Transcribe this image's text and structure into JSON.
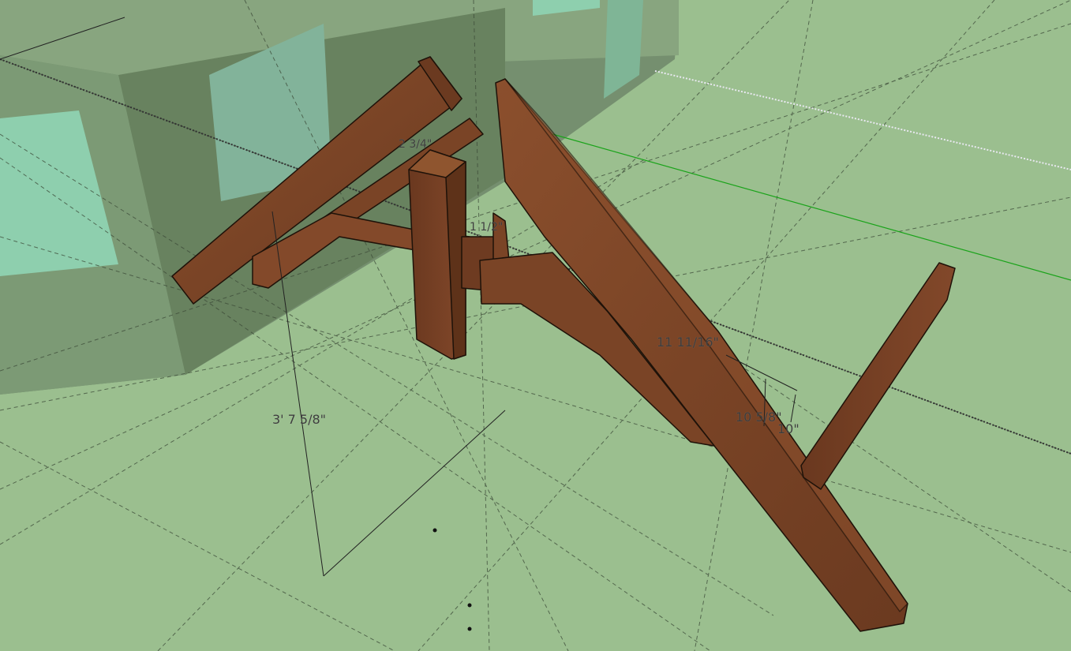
{
  "viewport": {
    "background_color": "#9bbf8f",
    "wood_color": "#7a4426",
    "wood_dark_color": "#4f2a16",
    "wood_light_color": "#8f552f",
    "wall_color": "#6f8a69",
    "window_color": "#8ecfae",
    "green_axis_color": "#1aa31a"
  },
  "dimensions": {
    "total_height": "3' 7 5/8\"",
    "offset_a": "11 11/16\"",
    "offset_b": "10 5/8\"",
    "offset_c": "10\"",
    "joint_top": "2 3/4\"",
    "joint_mid": "1 1/2\""
  }
}
